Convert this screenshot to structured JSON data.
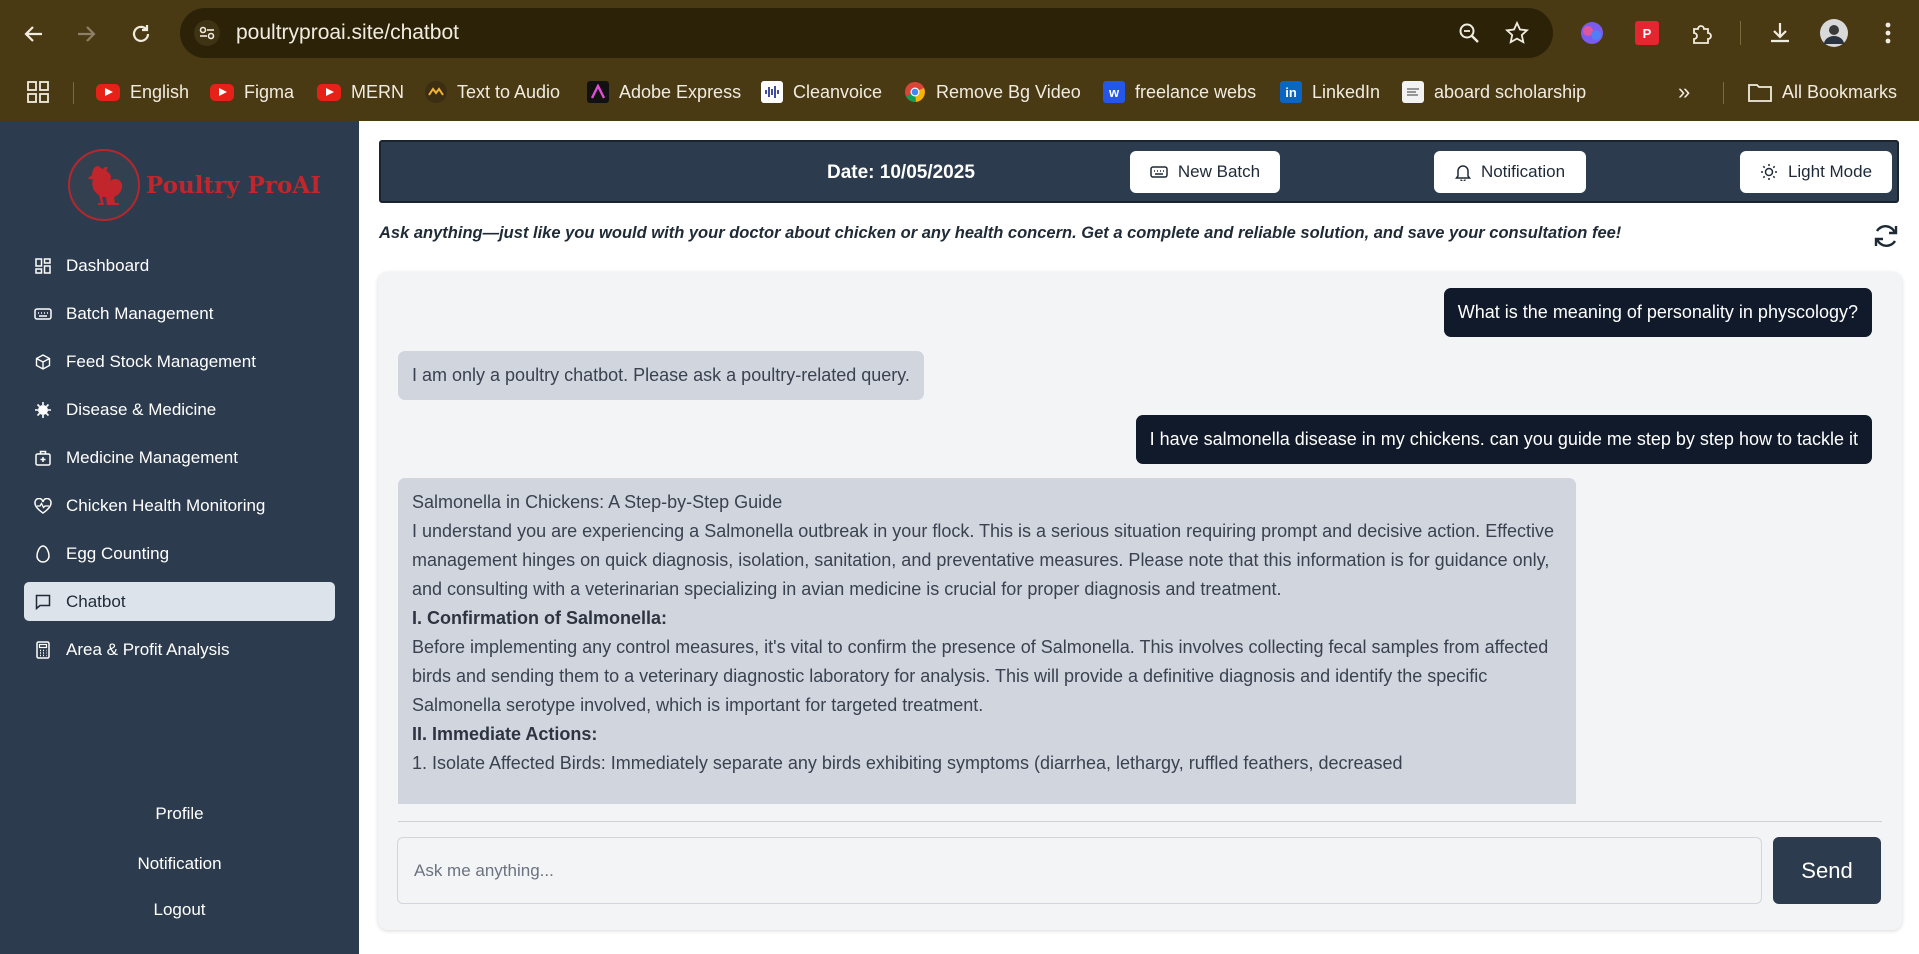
{
  "browser": {
    "url": "poultryproai.site/chatbot",
    "bookmarks": [
      {
        "label": "English",
        "icon": "youtube-icon"
      },
      {
        "label": "Figma",
        "icon": "youtube-icon"
      },
      {
        "label": "MERN",
        "icon": "youtube-icon"
      },
      {
        "label": "Text to Audio",
        "icon": "audio-icon"
      },
      {
        "label": "Adobe Express",
        "icon": "adobe-icon"
      },
      {
        "label": "Cleanvoice",
        "icon": "waveform-icon"
      },
      {
        "label": "Remove Bg Video",
        "icon": "chrome-icon"
      },
      {
        "label": "freelance webs",
        "icon": "webflow-icon"
      },
      {
        "label": "LinkedIn",
        "icon": "linkedin-icon"
      },
      {
        "label": "aboard scholarship",
        "icon": "doc-icon"
      }
    ],
    "all_bookmarks": "All Bookmarks",
    "more": "»"
  },
  "sidebar": {
    "logo_text": "Poultry ProAI",
    "items": [
      {
        "label": "Dashboard",
        "icon": "grid-icon"
      },
      {
        "label": "Batch Management",
        "icon": "keyboard-icon"
      },
      {
        "label": "Feed Stock Management",
        "icon": "box-icon"
      },
      {
        "label": "Disease & Medicine",
        "icon": "virus-icon"
      },
      {
        "label": "Medicine Management",
        "icon": "medkit-icon"
      },
      {
        "label": "Chicken Health Monitoring",
        "icon": "heart-pulse-icon"
      },
      {
        "label": "Egg Counting",
        "icon": "egg-icon"
      },
      {
        "label": "Chatbot",
        "icon": "chat-icon"
      },
      {
        "label": "Area & Profit Analysis",
        "icon": "calculator-icon"
      }
    ],
    "profile": "Profile",
    "notification": "Notification",
    "logout": "Logout"
  },
  "topbar": {
    "date": "Date: 10/05/2025",
    "new_batch": "New Batch",
    "notification": "Notification",
    "light_mode": "Light Mode"
  },
  "tagline": "Ask anything—just like you would with your doctor about chicken or any health concern. Get a complete and reliable solution, and save your consultation fee!",
  "chat": {
    "messages": [
      {
        "role": "user",
        "text": "What is the meaning of personality in physcology?"
      },
      {
        "role": "bot",
        "text": "I am only a poultry chatbot. Please ask a poultry-related query."
      },
      {
        "role": "user",
        "text": "I have salmonella disease in my chickens. can you guide me step by step how to tackle it"
      }
    ],
    "response": {
      "title": "Salmonella in Chickens: A Step-by-Step Guide",
      "intro": "I understand you are experiencing a Salmonella outbreak in your flock. This is a serious situation requiring prompt and decisive action. Effective management hinges on quick diagnosis, isolation, sanitation, and preventative measures. Please note that this information is for guidance only, and consulting with a veterinarian specializing in avian medicine is crucial for proper diagnosis and treatment.",
      "h1": "I. Confirmation of Salmonella:",
      "p1": "Before implementing any control measures, it's vital to confirm the presence of Salmonella. This involves collecting fecal samples from affected birds and sending them to a veterinary diagnostic laboratory for analysis. This will provide a definitive diagnosis and identify the specific Salmonella serotype involved, which is important for targeted treatment.",
      "h2": "II. Immediate Actions:",
      "p2": "1. Isolate Affected Birds: Immediately separate any birds exhibiting symptoms (diarrhea, lethargy, ruffled feathers, decreased"
    },
    "input_placeholder": "Ask me anything...",
    "send": "Send"
  }
}
